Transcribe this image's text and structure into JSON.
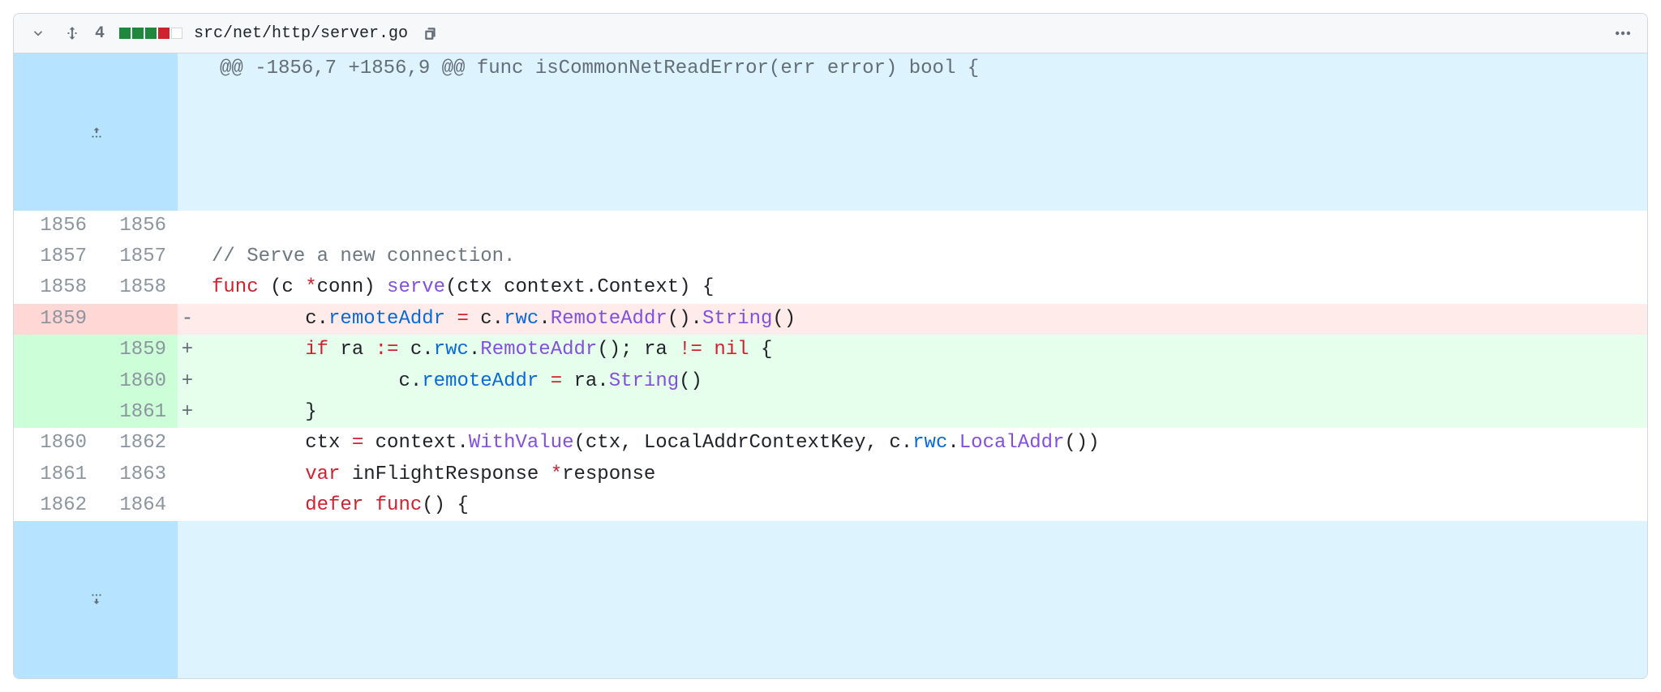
{
  "file": {
    "path": "src/net/http/server.go",
    "change_count": "4",
    "stat_squares": [
      "g",
      "g",
      "g",
      "r",
      "e"
    ]
  },
  "hunk": {
    "header": "@@ -1856,7 +1856,9 @@ func isCommonNetReadError(err error) bool {"
  },
  "rows": [
    {
      "type": "ctx",
      "la": "1856",
      "lb": "1856",
      "marker": "",
      "segs": [
        {
          "t": ""
        }
      ]
    },
    {
      "type": "ctx",
      "la": "1857",
      "lb": "1857",
      "marker": "",
      "segs": [
        {
          "t": "// Serve a new connection.",
          "c": "c-cm"
        }
      ]
    },
    {
      "type": "ctx",
      "la": "1858",
      "lb": "1858",
      "marker": "",
      "segs": [
        {
          "t": "func",
          "c": "c-k"
        },
        {
          "t": " (c "
        },
        {
          "t": "*",
          "c": "c-k"
        },
        {
          "t": "conn"
        },
        {
          "t": ") "
        },
        {
          "t": "serve",
          "c": "c-fn"
        },
        {
          "t": "(ctx "
        },
        {
          "t": "context"
        },
        {
          "t": "."
        },
        {
          "t": "Context"
        },
        {
          "t": ") {"
        }
      ]
    },
    {
      "type": "del",
      "la": "1859",
      "lb": "",
      "marker": "-",
      "segs": [
        {
          "t": "\tc."
        },
        {
          "t": "remoteAddr",
          "c": "c-id"
        },
        {
          "t": " "
        },
        {
          "t": "=",
          "c": "c-k"
        },
        {
          "t": " c."
        },
        {
          "t": "rwc",
          "c": "c-id"
        },
        {
          "t": "."
        },
        {
          "t": "RemoteAddr",
          "c": "c-fn"
        },
        {
          "t": "()."
        },
        {
          "t": "String",
          "c": "c-fn"
        },
        {
          "t": "()"
        }
      ]
    },
    {
      "type": "add",
      "la": "",
      "lb": "1859",
      "marker": "+",
      "segs": [
        {
          "t": "\t"
        },
        {
          "t": "if",
          "c": "c-k"
        },
        {
          "t": " ra "
        },
        {
          "t": ":=",
          "c": "c-k"
        },
        {
          "t": " c."
        },
        {
          "t": "rwc",
          "c": "c-id"
        },
        {
          "t": "."
        },
        {
          "t": "RemoteAddr",
          "c": "c-fn"
        },
        {
          "t": "(); ra "
        },
        {
          "t": "!=",
          "c": "c-k"
        },
        {
          "t": " "
        },
        {
          "t": "nil",
          "c": "c-k"
        },
        {
          "t": " {"
        }
      ]
    },
    {
      "type": "add",
      "la": "",
      "lb": "1860",
      "marker": "+",
      "segs": [
        {
          "t": "\t\tc."
        },
        {
          "t": "remoteAddr",
          "c": "c-id"
        },
        {
          "t": " "
        },
        {
          "t": "=",
          "c": "c-k"
        },
        {
          "t": " ra."
        },
        {
          "t": "String",
          "c": "c-fn"
        },
        {
          "t": "()"
        }
      ]
    },
    {
      "type": "add",
      "la": "",
      "lb": "1861",
      "marker": "+",
      "segs": [
        {
          "t": "\t}"
        }
      ]
    },
    {
      "type": "ctx",
      "la": "1860",
      "lb": "1862",
      "marker": "",
      "segs": [
        {
          "t": "\tctx "
        },
        {
          "t": "=",
          "c": "c-k"
        },
        {
          "t": " context."
        },
        {
          "t": "WithValue",
          "c": "c-fn"
        },
        {
          "t": "(ctx, LocalAddrContextKey, c."
        },
        {
          "t": "rwc",
          "c": "c-id"
        },
        {
          "t": "."
        },
        {
          "t": "LocalAddr",
          "c": "c-fn"
        },
        {
          "t": "())"
        }
      ]
    },
    {
      "type": "ctx",
      "la": "1861",
      "lb": "1863",
      "marker": "",
      "segs": [
        {
          "t": "\t"
        },
        {
          "t": "var",
          "c": "c-k"
        },
        {
          "t": " inFlightResponse "
        },
        {
          "t": "*",
          "c": "c-k"
        },
        {
          "t": "response"
        }
      ]
    },
    {
      "type": "ctx",
      "la": "1862",
      "lb": "1864",
      "marker": "",
      "segs": [
        {
          "t": "\t"
        },
        {
          "t": "defer",
          "c": "c-k"
        },
        {
          "t": " "
        },
        {
          "t": "func",
          "c": "c-k"
        },
        {
          "t": "() {"
        }
      ]
    }
  ]
}
